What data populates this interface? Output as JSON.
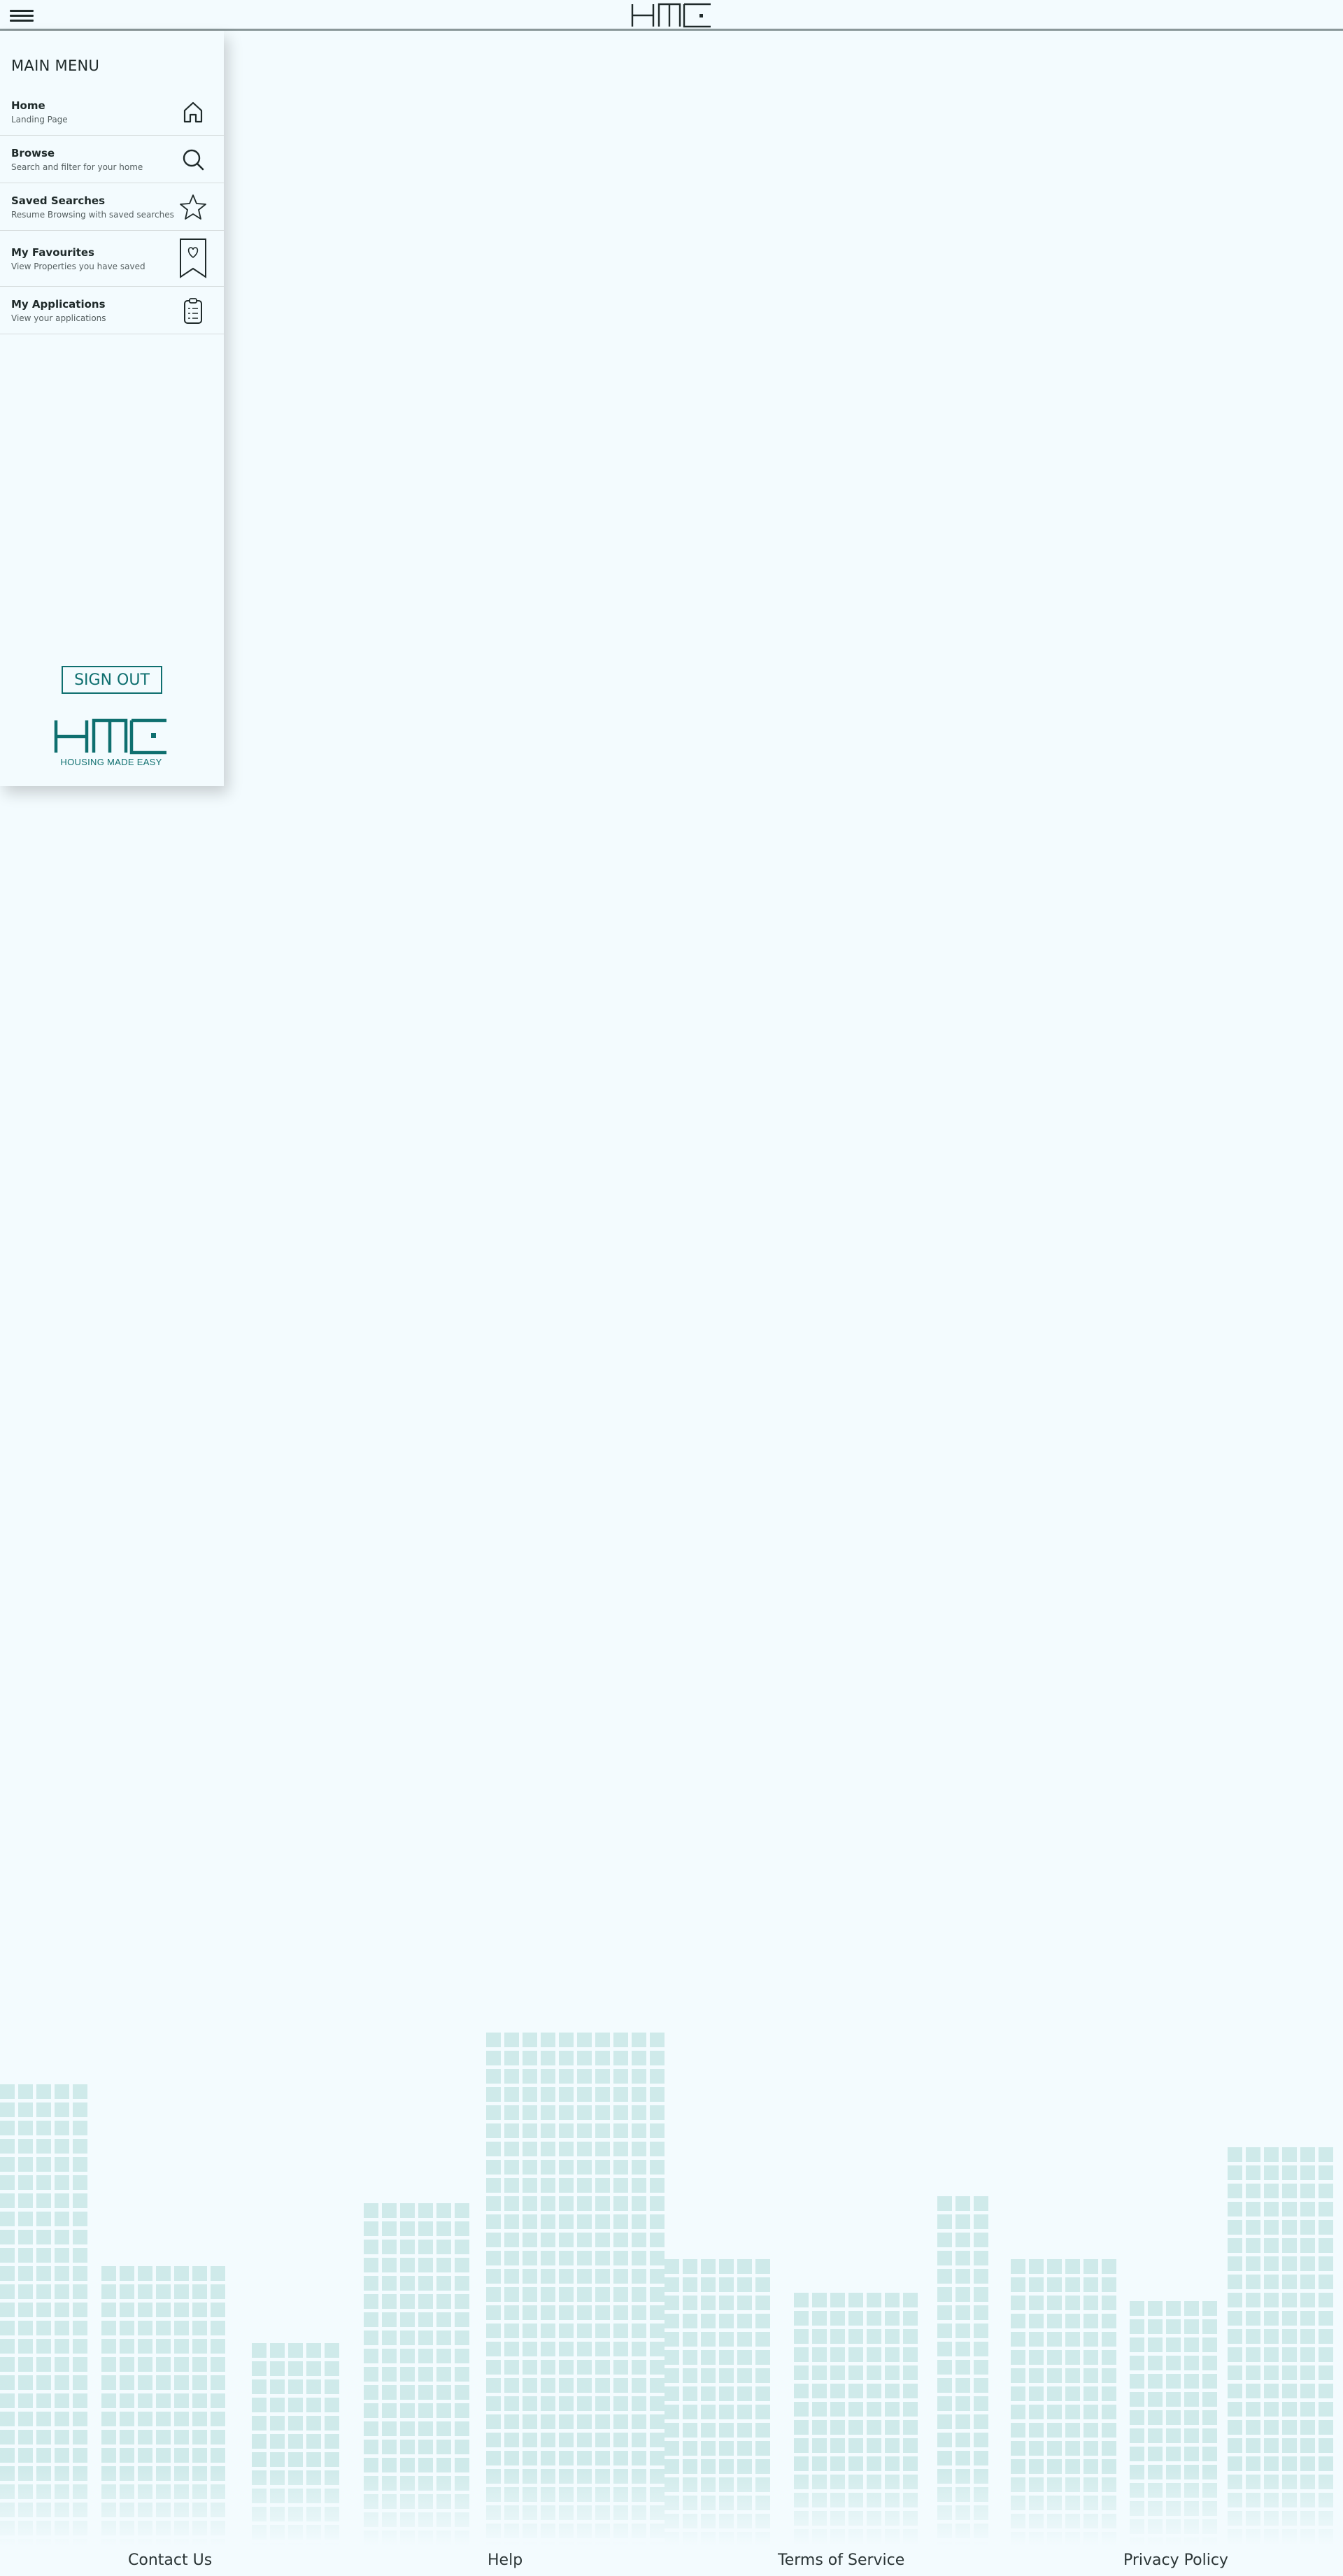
{
  "header": {
    "menu_icon": "hamburger-icon",
    "logo_text": "HME"
  },
  "drawer": {
    "title": "MAIN MENU",
    "items": [
      {
        "label": "Home",
        "sub": "Landing Page",
        "icon": "home-icon"
      },
      {
        "label": "Browse",
        "sub": "Search and filter for your home",
        "icon": "search-icon"
      },
      {
        "label": "Saved Searches",
        "sub": "Resume Browsing with saved searches",
        "icon": "star-icon"
      },
      {
        "label": "My Favourites",
        "sub": "View Properties you have saved",
        "icon": "bookmark-heart-icon"
      },
      {
        "label": "My Applications",
        "sub": "View your applications",
        "icon": "clipboard-icon"
      }
    ],
    "signout_label": "SIGN OUT",
    "logo_text": "HME",
    "tagline": "HOUSING MADE EASY"
  },
  "footer": {
    "links": [
      "Contact Us",
      "Help",
      "Terms of Service",
      "Privacy Policy"
    ]
  },
  "colors": {
    "background": "#F3FBFE",
    "accent": "#0E6F6F",
    "text": "#1F2A2A",
    "skyline": "#CFEAEA"
  }
}
